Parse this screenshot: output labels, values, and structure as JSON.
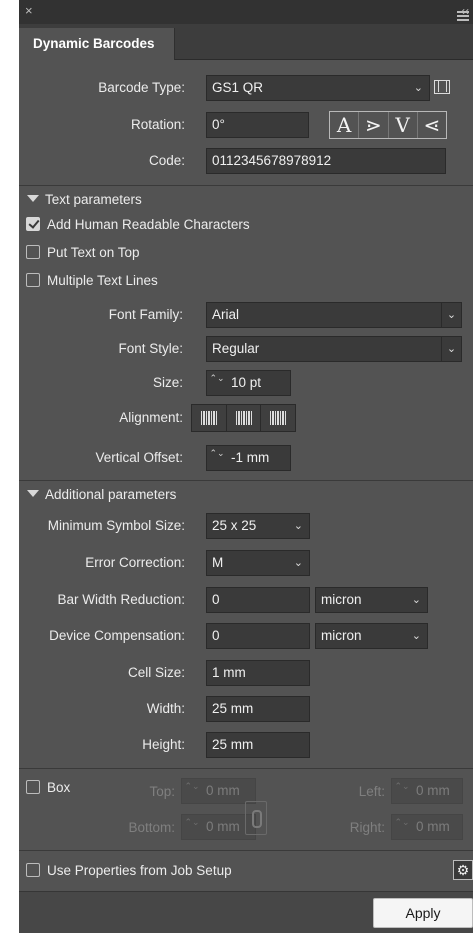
{
  "window": {
    "close_glyph": "×",
    "collapse_glyph": "‹‹"
  },
  "panel": {
    "tab_title": "Dynamic Barcodes",
    "menu_icon": "hamburger-icon"
  },
  "general": {
    "barcode_type_label": "Barcode Type:",
    "barcode_type_value": "GS1 QR",
    "rotation_label": "Rotation:",
    "rotation_value": "0°",
    "rotation_buttons": [
      "A",
      "⋗",
      "V",
      "⋖"
    ],
    "code_label": "Code:",
    "code_value": "0112345678978912"
  },
  "text_parameters": {
    "header": "Text parameters",
    "add_human_readable": {
      "label": "Add Human Readable Characters",
      "checked": true
    },
    "text_on_top": {
      "label": "Put Text on Top",
      "checked": false
    },
    "multiple_lines": {
      "label": "Multiple Text Lines",
      "checked": false
    },
    "font_family_label": "Font Family:",
    "font_family_value": "Arial",
    "font_style_label": "Font Style:",
    "font_style_value": "Regular",
    "size_label": "Size:",
    "size_value": "10 pt",
    "alignment_label": "Alignment:",
    "vertical_offset_label": "Vertical Offset:",
    "vertical_offset_value": "-1 mm"
  },
  "additional_parameters": {
    "header": "Additional parameters",
    "min_symbol_label": "Minimum Symbol Size:",
    "min_symbol_value": "25 x 25",
    "error_correction_label": "Error Correction:",
    "error_correction_value": "M",
    "bar_width_label": "Bar Width Reduction:",
    "bar_width_value": "0",
    "bar_width_unit": "micron",
    "device_comp_label": "Device Compensation:",
    "device_comp_value": "0",
    "device_comp_unit": "micron",
    "cell_size_label": "Cell Size:",
    "cell_size_value": "1 mm",
    "width_label": "Width:",
    "width_value": "25 mm",
    "height_label": "Height:",
    "height_value": "25 mm"
  },
  "box": {
    "label": "Box",
    "checked": false,
    "top_label": "Top:",
    "top_value": "0 mm",
    "bottom_label": "Bottom:",
    "bottom_value": "0 mm",
    "left_label": "Left:",
    "left_value": "0 mm",
    "right_label": "Right:",
    "right_value": "0 mm"
  },
  "footer": {
    "job_setup_label": "Use Properties from Job Setup",
    "job_setup_checked": false,
    "apply_label": "Apply"
  },
  "glyphs": {
    "chevron": "⌄",
    "spin": "⌃⌄"
  }
}
